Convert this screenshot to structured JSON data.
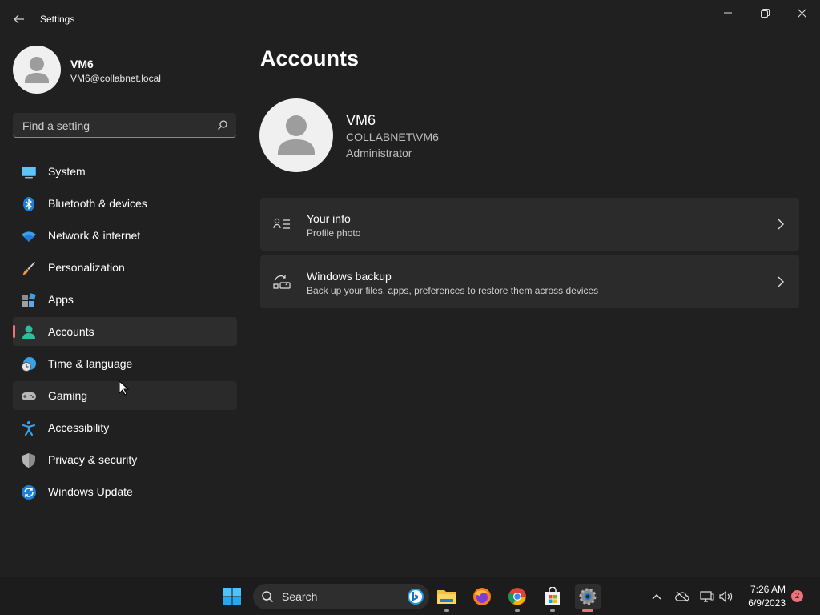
{
  "window": {
    "title": "Settings"
  },
  "sidebar": {
    "profile": {
      "name": "VM6",
      "email": "VM6@collabnet.local"
    },
    "search": {
      "placeholder": "Find a setting"
    },
    "items": [
      {
        "label": "System",
        "icon": "system-icon"
      },
      {
        "label": "Bluetooth & devices",
        "icon": "bluetooth-icon"
      },
      {
        "label": "Network & internet",
        "icon": "wifi-icon"
      },
      {
        "label": "Personalization",
        "icon": "brush-icon"
      },
      {
        "label": "Apps",
        "icon": "apps-icon"
      },
      {
        "label": "Accounts",
        "icon": "accounts-icon",
        "selected": true
      },
      {
        "label": "Time & language",
        "icon": "globe-clock-icon"
      },
      {
        "label": "Gaming",
        "icon": "gamepad-icon"
      },
      {
        "label": "Accessibility",
        "icon": "accessibility-icon"
      },
      {
        "label": "Privacy & security",
        "icon": "shield-icon"
      },
      {
        "label": "Windows Update",
        "icon": "update-icon"
      }
    ]
  },
  "main": {
    "title": "Accounts",
    "account": {
      "name": "VM6",
      "domain_user": "COLLABNET\\VM6",
      "role": "Administrator"
    },
    "cards": [
      {
        "title": "Your info",
        "subtitle": "Profile photo",
        "icon": "person-info-icon"
      },
      {
        "title": "Windows backup",
        "subtitle": "Back up your files, apps, preferences to restore them across devices",
        "icon": "backup-sync-icon"
      }
    ]
  },
  "taskbar": {
    "search_label": "Search",
    "apps": [
      "file-explorer-icon",
      "firefox-icon",
      "chrome-icon",
      "store-icon",
      "settings-icon"
    ],
    "clock": {
      "time": "7:26 AM",
      "date": "6/9/2023"
    },
    "notification_count": "2"
  },
  "colors": {
    "accent": "#f1707a",
    "background": "#202020",
    "card": "#2b2b2b"
  }
}
